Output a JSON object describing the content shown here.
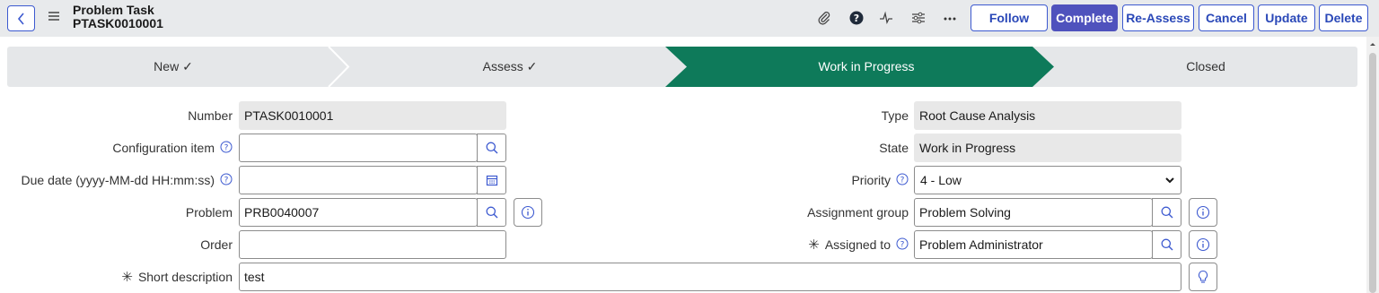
{
  "header": {
    "title": "Problem Task",
    "number": "PTASK0010001",
    "buttons": {
      "follow": "Follow",
      "complete": "Complete",
      "reassess": "Re-Assess",
      "cancel": "Cancel",
      "update": "Update",
      "delete": "Delete"
    },
    "icons": [
      "paperclip-icon",
      "help-icon",
      "activity-icon",
      "settings-sliders-icon",
      "more-icon"
    ]
  },
  "stages": [
    {
      "label": "New ✓",
      "state": "done"
    },
    {
      "label": "Assess ✓",
      "state": "done"
    },
    {
      "label": "Work in Progress",
      "state": "active"
    },
    {
      "label": "Closed",
      "state": "pending"
    }
  ],
  "colors": {
    "accent": "#4f52bd",
    "stage_active": "#0e7a5a",
    "stage_inactive": "#e5e7e9"
  },
  "form": {
    "number": {
      "label": "Number",
      "value": "PTASK0010001"
    },
    "configuration_item": {
      "label": "Configuration item",
      "value": ""
    },
    "due_date": {
      "label": "Due date (yyyy-MM-dd HH:mm:ss)",
      "value": ""
    },
    "problem": {
      "label": "Problem",
      "value": "PRB0040007"
    },
    "order": {
      "label": "Order",
      "value": ""
    },
    "short_description": {
      "label": "Short description",
      "value": "test",
      "required": true
    },
    "type": {
      "label": "Type",
      "value": "Root Cause Analysis"
    },
    "state": {
      "label": "State",
      "value": "Work in Progress"
    },
    "priority": {
      "label": "Priority",
      "value": "4 - Low"
    },
    "assignment_group": {
      "label": "Assignment group",
      "value": "Problem Solving"
    },
    "assigned_to": {
      "label": "Assigned to",
      "value": "Problem Administrator",
      "required": true
    }
  }
}
